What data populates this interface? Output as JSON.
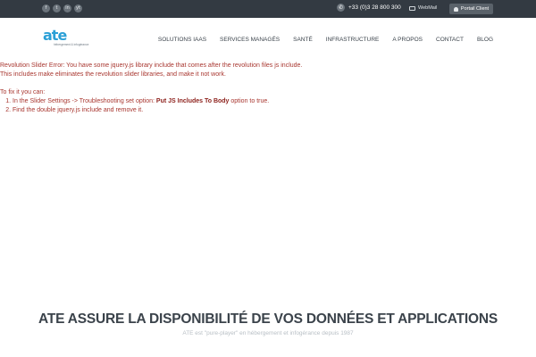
{
  "topbar": {
    "social": [
      "f",
      "t",
      "in",
      "yt"
    ],
    "phone": "+33 (0)3 28 800 300",
    "webmail": "WebMail",
    "portal": "Portail Client"
  },
  "logo": {
    "mark": "ate",
    "tagline": "hébergement & infogérance"
  },
  "nav": [
    "SOLUTIONS IAAS",
    "SERVICES MANAGÉS",
    "SANTÉ",
    "INFRASTRUCTURE",
    "A PROPOS",
    "CONTACT",
    "BLOG"
  ],
  "error": {
    "line1": "Revolution Slider Error: You have some jquery.js library include that comes after the revolution files js include.",
    "line2": "This includes make eliminates the revolution slider libraries, and make it not work.",
    "fix_intro": "To fix it you can:",
    "step1_pre": "In the Slider Settings -> Troubleshooting set option: ",
    "step1_strong": "Put JS Includes To Body",
    "step1_post": " option to true.",
    "step2": "Find the double jquery.js include and remove it."
  },
  "hero": {
    "title": "ATE ASSURE LA DISPONIBILITÉ DE VOS DONNÉES ET APPLICATIONS",
    "subtitle": "ATE est \"pure-player\" en hébergement et infogérance depuis 1987"
  }
}
